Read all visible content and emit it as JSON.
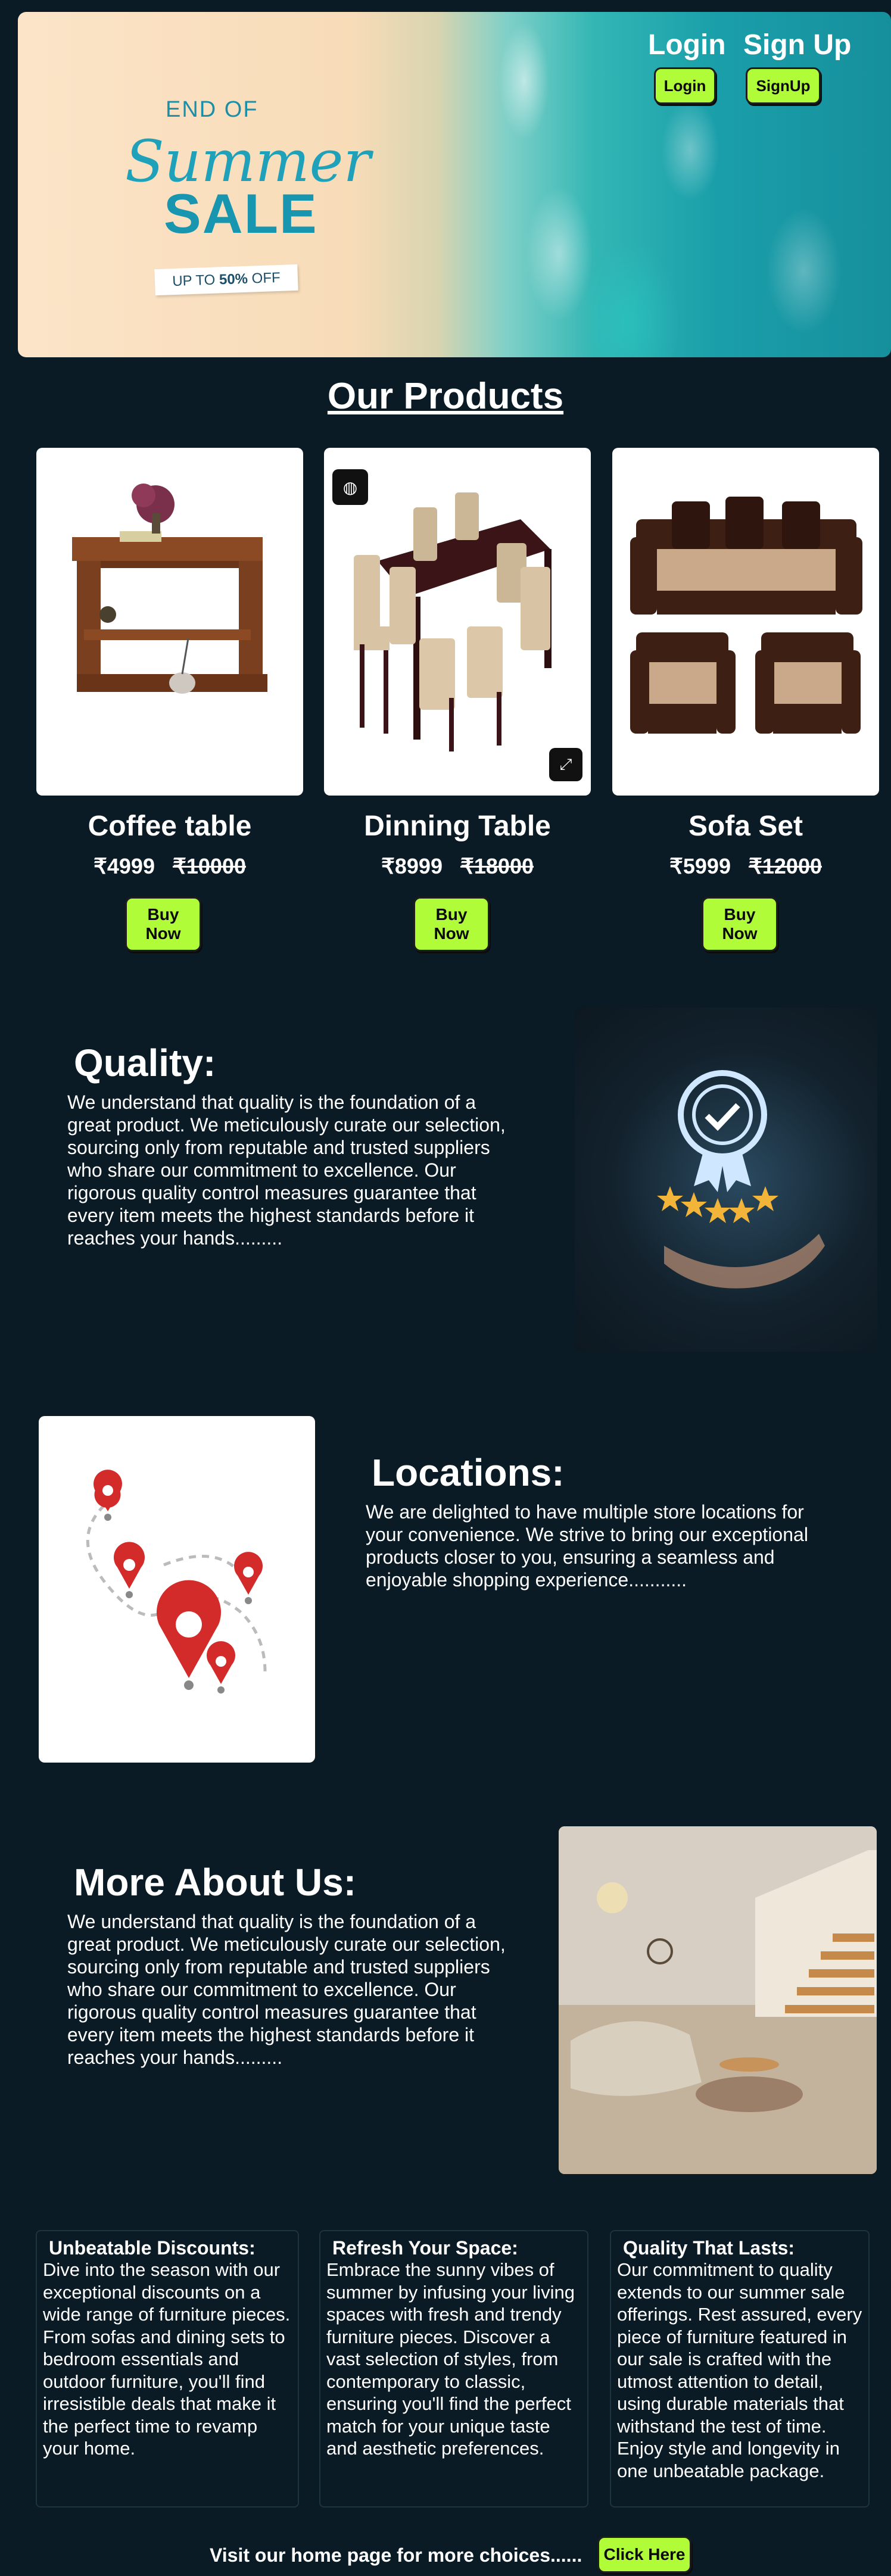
{
  "hero": {
    "promo_top": "END OF",
    "promo_script": "Summer",
    "promo_sale": "SALE",
    "promo_off_prefix": "UP TO ",
    "promo_off_value": "50%",
    "promo_off_suffix": " OFF",
    "login_label": "Login",
    "signup_label": "Sign Up",
    "login_button": "Login",
    "signup_button": "SignUp"
  },
  "products": {
    "title": "Our Products",
    "items": [
      {
        "name": "Coffee table",
        "price": "₹4999",
        "old_price": "₹10000",
        "button": "Buy Now"
      },
      {
        "name": "Dinning Table",
        "price": "₹8999",
        "old_price": "₹18000",
        "button": "Buy Now"
      },
      {
        "name": "Sofa Set",
        "price": "₹5999",
        "old_price": "₹12000",
        "button": "Buy Now"
      }
    ]
  },
  "quality": {
    "title": "Quality:",
    "text": "We understand that quality is the foundation of a great product. We meticulously curate our selection, sourcing only from reputable and trusted suppliers who share our commitment to excellence. Our rigorous quality control measures guarantee that every item meets the highest standards before it reaches your hands........."
  },
  "locations": {
    "title": "Locations:",
    "text": "We are delighted to have multiple store locations for your convenience. We strive to bring our exceptional products closer to you, ensuring a seamless and enjoyable shopping experience..........."
  },
  "about": {
    "title": "More About Us:",
    "text": "We understand that quality is the foundation of a great product. We meticulously curate our selection, sourcing only from reputable and trusted suppliers who share our commitment to excellence. Our rigorous quality control measures guarantee that every item meets the highest standards before it reaches your hands........."
  },
  "features": [
    {
      "title": "Unbeatable Discounts:",
      "text": "Dive into the season with our exceptional discounts on a wide range of furniture pieces. From sofas and dining sets to bedroom essentials and outdoor furniture, you'll find irresistible deals that make it the perfect time to revamp your home."
    },
    {
      "title": "Refresh Your Space:",
      "text": "Embrace the sunny vibes of summer by infusing your living spaces with fresh and trendy furniture pieces. Discover a vast selection of styles, from contemporary to classic, ensuring you'll find the perfect match for your unique taste and aesthetic preferences."
    },
    {
      "title": "Quality That Lasts:",
      "text": "Our commitment to quality extends to our summer sale offerings. Rest assured, every piece of furniture featured in our sale is crafted with the utmost attention to detail, using durable materials that withstand the test of time. Enjoy style and longevity in one unbeatable package."
    }
  ],
  "footer": {
    "text": "Visit our home page for more choices......",
    "button": "Click Here"
  },
  "colors": {
    "background": "#0a1b26",
    "button_green": "#b0fc38"
  }
}
